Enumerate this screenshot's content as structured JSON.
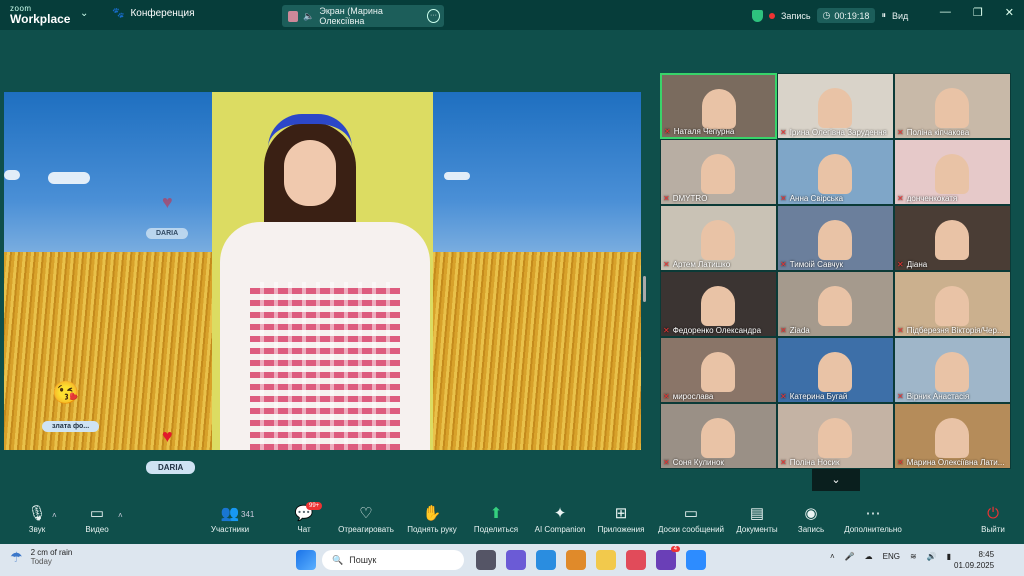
{
  "app": {
    "brand_top": "zoom",
    "brand_bottom": "Workplace",
    "meeting_label": "Конференция"
  },
  "share_tab": {
    "label": "Экран (Марина Олексіївна"
  },
  "recording": {
    "label": "Запись",
    "timer": "00:19:18",
    "view_label": "Вид"
  },
  "shared_screen": {
    "tag_daria_top": "DARIA",
    "tag_zlata": "злата фо...",
    "tag_daria_bottom": "DARIA"
  },
  "gallery": [
    {
      "name": "Наталя Чепурна",
      "bg": "#7a6b5e",
      "active": true
    },
    {
      "name": "Ірина Олегівна Зарудення",
      "bg": "#d9d3c9",
      "active": false
    },
    {
      "name": "Поліна кіпчакова",
      "bg": "#c8b9a8",
      "active": false
    },
    {
      "name": "DMYTRO",
      "bg": "#b8aea3",
      "active": false
    },
    {
      "name": "Анна Свірська",
      "bg": "#7fa6c8",
      "active": false
    },
    {
      "name": "донченкокатя",
      "bg": "#e6c9c9",
      "active": false
    },
    {
      "name": "Артем Латишко",
      "bg": "#c9c2b5",
      "active": false
    },
    {
      "name": "Тимоій Савчук",
      "bg": "#6b7f9c",
      "active": false
    },
    {
      "name": "Діана",
      "bg": "#4a3d35",
      "active": false
    },
    {
      "name": "Федоренко Олександра",
      "bg": "#3b3432",
      "active": false
    },
    {
      "name": "Ziada",
      "bg": "#a59a8d",
      "active": false
    },
    {
      "name": "Підберезня Вікторія/Чер...",
      "bg": "#cbb08e",
      "active": false
    },
    {
      "name": "мирослава",
      "bg": "#8a7568",
      "active": false
    },
    {
      "name": "Катерина Бугай",
      "bg": "#3d6fa8",
      "active": false
    },
    {
      "name": "Вірник Анастасія",
      "bg": "#9fb6c9",
      "active": false
    },
    {
      "name": "Соня Кулинок",
      "bg": "#9a9086",
      "active": false
    },
    {
      "name": "Поліна Носик",
      "bg": "#c4b3a4",
      "active": false
    },
    {
      "name": "Марина Олексіївна Лати...",
      "bg": "#b58c5a",
      "active": false
    }
  ],
  "toolbar": {
    "audio": "Звук",
    "video": "Видео",
    "participants": "Участники",
    "participants_count": "341",
    "chat": "Чат",
    "chat_badge": "99+",
    "react": "Отреагировать",
    "raise": "Поднять руку",
    "share": "Поделиться",
    "ai": "AI Companion",
    "apps": "Приложения",
    "whiteboard": "Доски сообщений",
    "docs": "Документы",
    "record": "Запись",
    "more": "Дополнительно",
    "leave": "Выйти"
  },
  "taskbar": {
    "weather_temp": "2 cm of rain",
    "weather_sub": "Today",
    "search_placeholder": "Пошук",
    "lang": "ENG",
    "time": "8:45",
    "date": "01.09.2025",
    "notif_count": "4"
  }
}
